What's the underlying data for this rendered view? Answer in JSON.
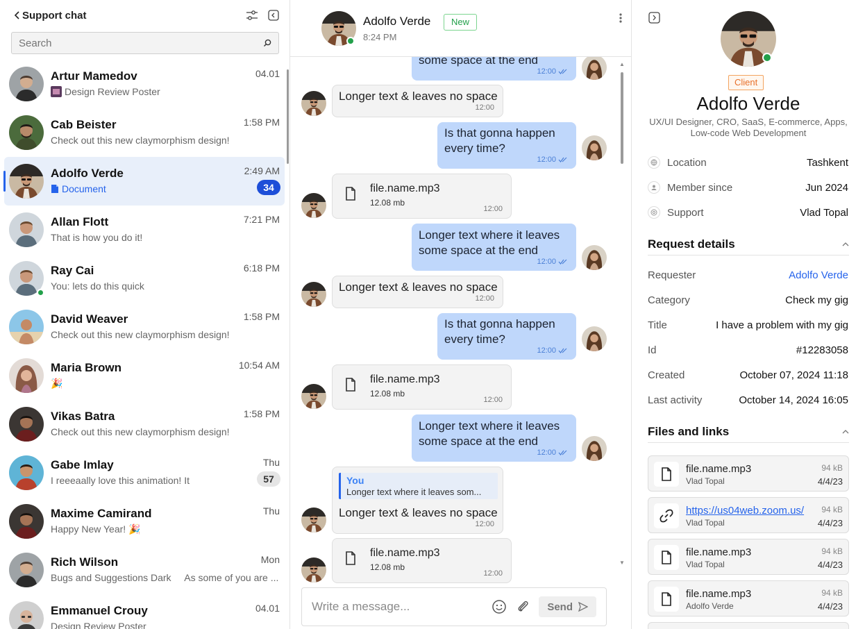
{
  "colors": {
    "accent": "#2563eb",
    "online": "#22a04a",
    "client_badge": "#e8702a",
    "new_badge": "#22a04a",
    "outgoing_bubble": "#bfd7fb"
  },
  "sidebar": {
    "back_icon": "chevron-left-icon",
    "title": "Support chat",
    "search_placeholder": "Search",
    "chats": [
      {
        "name": "Artur Mamedov",
        "time": "04.01",
        "preview": "Design Review Poster",
        "preview_icon": "image-thumbnail-icon"
      },
      {
        "name": "Cab Beister",
        "time": "1:58 PM",
        "preview": "Check out this new claymorphism design!"
      },
      {
        "name": "Adolfo Verde",
        "time": "2:49 AM",
        "preview": "Document",
        "preview_icon": "document-icon",
        "badge": "34",
        "active": true
      },
      {
        "name": "Allan Flott",
        "time": "7:21 PM",
        "preview": "That is how you do it!"
      },
      {
        "name": "Ray Cai",
        "time": "6:18 PM",
        "preview": "You: lets do this quick",
        "online": true
      },
      {
        "name": "David Weaver",
        "time": "1:58 PM",
        "preview": "Check out this new claymorphism design!"
      },
      {
        "name": "Maria Brown",
        "time": "10:54 AM",
        "preview": "🎉"
      },
      {
        "name": "Vikas Batra",
        "time": "1:58 PM",
        "preview": "Check out this new claymorphism design!"
      },
      {
        "name": "Gabe Imlay",
        "time": "Thu",
        "preview": "I reeeaally love this animation! It",
        "badge": "57"
      },
      {
        "name": "Maxime Camirand",
        "time": "Thu",
        "preview": "Happy New Year! 🎉"
      },
      {
        "name": "Rich Wilson",
        "time": "Mon",
        "preview": "Bugs and Suggestions Dark     As some of you are ..."
      },
      {
        "name": "Emmanuel Crouy",
        "time": "04.01",
        "preview": "Design Review Poster"
      }
    ]
  },
  "chat": {
    "name": "Adolfo Verde",
    "status_badge": "New",
    "subtitle": "8:24 PM",
    "messages": [
      {
        "text": "Longer text where it leaves some space at the end",
        "clipped_line": "some space at the end",
        "time": "12:00"
      },
      {
        "text": "Longer text & leaves no space",
        "time": "12:00"
      },
      {
        "text": "Is that gonna happen every time?",
        "time": "12:00"
      },
      {
        "file": "file.name.mp3",
        "size": "12.08 mb",
        "time": "12:00"
      },
      {
        "text": "Longer text where it leaves some space at the end",
        "time": "12:00"
      },
      {
        "text": "Longer text & leaves no space",
        "time": "12:00"
      },
      {
        "text": "Is that gonna happen every time?",
        "time": "12:00"
      },
      {
        "file": "file.name.mp3",
        "size": "12.08 mb",
        "time": "12:00"
      },
      {
        "text": "Longer text where it leaves some space at the end",
        "time": "12:00"
      },
      {
        "reply_who": "You",
        "reply_text": "Longer text where it leaves som...",
        "text": "Longer text & leaves no space",
        "time": "12:00"
      },
      {
        "file": "file.name.mp3",
        "size": "12.08 mb",
        "time": "12:00"
      }
    ],
    "composer_placeholder": "Write a message...",
    "send_label": "Send"
  },
  "profile": {
    "badge": "Client",
    "name": "Adolfo Verde",
    "role": "UX/UI Designer, CRO, SaaS, E-commerce, Apps, Low-code Web Development",
    "info": [
      {
        "icon": "globe-icon",
        "label": "Location",
        "value": "Tashkent"
      },
      {
        "icon": "user-icon",
        "label": "Member since",
        "value": "Jun 2024"
      },
      {
        "icon": "support-icon",
        "label": "Support",
        "value": "Vlad Topal"
      }
    ],
    "request_title": "Request details",
    "request": [
      {
        "label": "Requester",
        "value": "Adolfo Verde"
      },
      {
        "label": "Category",
        "value": "Check my gig"
      },
      {
        "label": "Title",
        "value": "I have a problem with my gig"
      },
      {
        "label": "Id",
        "value": "#12283058"
      },
      {
        "label": "Created",
        "value": "October 07, 2024 11:18"
      },
      {
        "label": "Last activity",
        "value": "October 14, 2024 16:05"
      }
    ],
    "files_title": "Files and links",
    "files": [
      {
        "icon": "file-icon",
        "name": "file.name.mp3",
        "owner": "Vlad Topal",
        "size": "94 kB",
        "date": "4/4/23"
      },
      {
        "icon": "link-icon",
        "name": "https://us04web.zoom.us/",
        "owner": "Vlad Topal",
        "size": "94 kB",
        "date": "4/4/23"
      },
      {
        "icon": "file-icon",
        "name": "file.name.mp3",
        "owner": "Vlad Topal",
        "size": "94 kB",
        "date": "4/4/23"
      },
      {
        "icon": "file-icon",
        "name": "file.name.mp3",
        "owner": "Adolfo Verde",
        "size": "94 kB",
        "date": "4/4/23"
      }
    ]
  }
}
